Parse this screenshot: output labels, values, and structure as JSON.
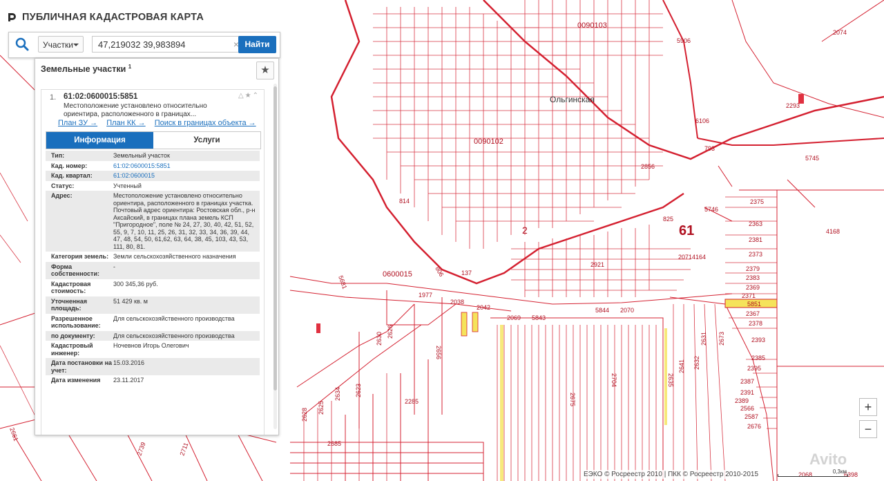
{
  "header": {
    "title": "ПУБЛИЧНАЯ КАДАСТРОВАЯ КАРТА"
  },
  "search": {
    "type_label": "Участки",
    "query": "47,219032 39,983894",
    "clear_label": "×",
    "button_label": "Найти"
  },
  "panel": {
    "title": "Земельные участки",
    "count": "1",
    "result": {
      "number": "1.",
      "cad_number": "61:02:0600015:5851",
      "description": "Местоположение установлено относительно ориентира, расположенного в границах...",
      "links": [
        "План ЗУ →",
        "План КК →",
        "Поиск в границах объекта →"
      ]
    },
    "tabs": [
      {
        "label": "Информация"
      },
      {
        "label": "Услуги"
      }
    ],
    "attributes": [
      {
        "k": "Тип:",
        "v": "Земельный участок"
      },
      {
        "k": "Кад. номер:",
        "v": "61:02:0600015:5851"
      },
      {
        "k": "Кад. квартал:",
        "v": "61:02:0600015"
      },
      {
        "k": "Статус:",
        "v": "Учтенный"
      },
      {
        "k": "Адрес:",
        "v": "Местоположение установлено относительно ориентира, расположенного в границах участка. Почтовый адрес ориентира: Ростовская обл., р-н Аксайский, в границах плана земель КСП \"Пригородное\", поле № 24, 27, 30, 40, 42, 51, 52, 55, 9, 7, 10, 11, 25, 26, 31, 32, 33, 34, 36, 39, 44, 47, 48, 54, 50, 61,62, 63, 64, 38, 45, 103, 43, 53, 111, 80, 81."
      },
      {
        "k": "Категория земель:",
        "v": "Земли сельскохозяйственного назначения"
      },
      {
        "k": "Форма собственности:",
        "v": "-"
      },
      {
        "k": "Кадастровая стоимость:",
        "v": "300 345,36 руб."
      },
      {
        "k": "Уточненная площадь:",
        "v": "51 429 кв. м"
      },
      {
        "k": "Разрешенное использование:",
        "v": "Для сельскохозяйственного производства"
      },
      {
        "k": "по документу:",
        "v": "Для сельскохозяйственного производства"
      },
      {
        "k": "Кадастровый инженер:",
        "v": "Ночевнов Игорь Олегович"
      },
      {
        "k": "Дата постановки на учет:",
        "v": "15.03.2016"
      },
      {
        "k": "Дата изменения",
        "v": "23.11.2017"
      }
    ]
  },
  "map": {
    "labels": [
      "0090103",
      "Ольгинская",
      "0090102",
      "0600015",
      "61",
      "2",
      "5906",
      "2074",
      "2293",
      "5745",
      "2856",
      "793",
      "6106",
      "814",
      "825",
      "5746",
      "2375",
      "2363",
      "2381",
      "2373",
      "2379",
      "2383",
      "2369",
      "2371",
      "5851",
      "2367",
      "2378",
      "2393",
      "2385",
      "2395",
      "2387",
      "2391",
      "2389",
      "2566",
      "2587",
      "2676",
      "4168",
      "2921",
      "2071",
      "4164",
      "1977",
      "2038",
      "2042",
      "2069",
      "5843",
      "5844",
      "2070",
      "5681",
      "2630",
      "2626",
      "2656",
      "2285",
      "2704",
      "2675",
      "2685",
      "2634",
      "2623",
      "2625",
      "2628",
      "2631",
      "2673",
      "2635",
      "2641",
      "2632",
      "2068",
      "6398",
      "806",
      "137",
      "2739",
      "2711",
      "2661"
    ],
    "highlight_color": "#f5e35a",
    "line_color": "#d42030"
  },
  "controls": {
    "zoom_in": "+",
    "zoom_out": "−"
  },
  "footer": {
    "copyright": "ЕЭКО © Росреестр 2010 | ПКК © Росреестр 2010-2015",
    "scale": "0,3км"
  },
  "watermark": "Avito"
}
